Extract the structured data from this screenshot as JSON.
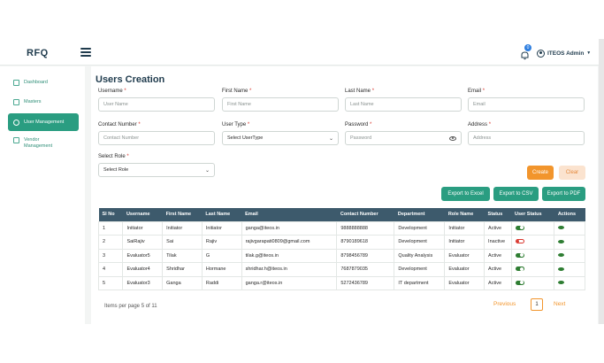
{
  "app": {
    "brand": "RFQ",
    "notification_count": "0",
    "user_name": "ITEOS Admin"
  },
  "sidebar": {
    "items": [
      {
        "label": "Dashboard",
        "icon": "dashboard-icon",
        "active": false
      },
      {
        "label": "Masters",
        "icon": "masters-icon",
        "active": false
      },
      {
        "label": "User Management",
        "icon": "user-icon",
        "active": true
      },
      {
        "label": "Vendor Management",
        "icon": "vendor-icon",
        "active": false
      }
    ]
  },
  "page": {
    "title": "Users Creation"
  },
  "form": {
    "username": {
      "label": "Username",
      "placeholder": "User Name"
    },
    "first_name": {
      "label": "First Name",
      "placeholder": "First Name"
    },
    "last_name": {
      "label": "Last Name",
      "placeholder": "Last Name"
    },
    "email": {
      "label": "Email",
      "placeholder": "Email"
    },
    "contact": {
      "label": "Contact Number",
      "placeholder": "Contact Number"
    },
    "user_type": {
      "label": "User Type",
      "value": "Select UserType"
    },
    "password": {
      "label": "Password",
      "placeholder": "Password"
    },
    "address": {
      "label": "Address",
      "placeholder": "Address"
    },
    "role": {
      "label": "Select Role",
      "value": "Select Role"
    },
    "required_mark": "*"
  },
  "actions": {
    "create": "Create",
    "clear": "Clear",
    "export_excel": "Export to Excel",
    "export_csv": "Export to CSV",
    "export_pdf": "Export to PDF"
  },
  "table": {
    "headers": [
      "Sl No",
      "Username",
      "First Name",
      "Last Name",
      "Email",
      "Contact Number",
      "Department",
      "Role Name",
      "Status",
      "User Status",
      "Actions"
    ],
    "rows": [
      {
        "sl": "1",
        "username": "Initiator",
        "first": "Initiator",
        "last": "Initiator",
        "email": "ganga@iteos.in",
        "contact": "9888888888",
        "dept": "Development",
        "role": "Initiator",
        "status": "Active",
        "enabled": true
      },
      {
        "sl": "2",
        "username": "SaiRajiv",
        "first": "Sai",
        "last": "Rajiv",
        "email": "rajivgarapati0809@gmail.com",
        "contact": "8790189618",
        "dept": "Development",
        "role": "Initiator",
        "status": "Inactive",
        "enabled": false
      },
      {
        "sl": "3",
        "username": "Evaluator5",
        "first": "Tilak",
        "last": "G",
        "email": "tilak.g@iteos.in",
        "contact": "8798456789",
        "dept": "Quality Analysis",
        "role": "Evaluator",
        "status": "Active",
        "enabled": true
      },
      {
        "sl": "4",
        "username": "Evaluator4",
        "first": "Shridhar",
        "last": "Hormane",
        "email": "shridhar.h@iteos.in",
        "contact": "7687879035",
        "dept": "Development",
        "role": "Evaluator",
        "status": "Active",
        "enabled": true
      },
      {
        "sl": "5",
        "username": "Evaluator3",
        "first": "Ganga",
        "last": "Raddi",
        "email": "ganga.r@iteos.in",
        "contact": "5272436789",
        "dept": "IT department",
        "role": "Evaluator",
        "status": "Active",
        "enabled": true
      }
    ]
  },
  "pagination": {
    "info": "Items per page 5 of 11",
    "prev": "Previous",
    "current": "1",
    "next": "Next"
  },
  "colors": {
    "accent": "#2a9d81",
    "header": "#3d5a6c",
    "create": "#f2952c"
  }
}
